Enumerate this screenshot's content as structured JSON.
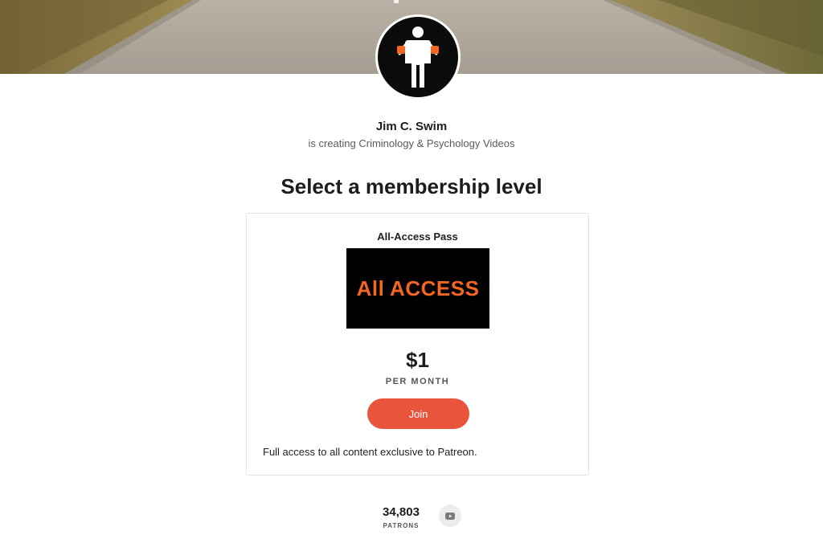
{
  "creator": {
    "name": "Jim C. Swim",
    "subtitle": "is creating Criminology & Psychology Videos"
  },
  "section": {
    "title": "Select a membership level"
  },
  "tier": {
    "name": "All-Access Pass",
    "image_text": "All ACCESS",
    "price": "$1",
    "period": "PER MONTH",
    "join_label": "Join",
    "description": "Full access to all content exclusive to Patreon."
  },
  "stats": {
    "patron_count": "34,803",
    "patron_label": "PATRONS"
  },
  "icons": {
    "avatar": "person-silhouette-icon",
    "social": "youtube-icon"
  },
  "colors": {
    "accent": "#e8553c",
    "tier_image_text": "#f26522",
    "tier_image_bg": "#000000"
  }
}
